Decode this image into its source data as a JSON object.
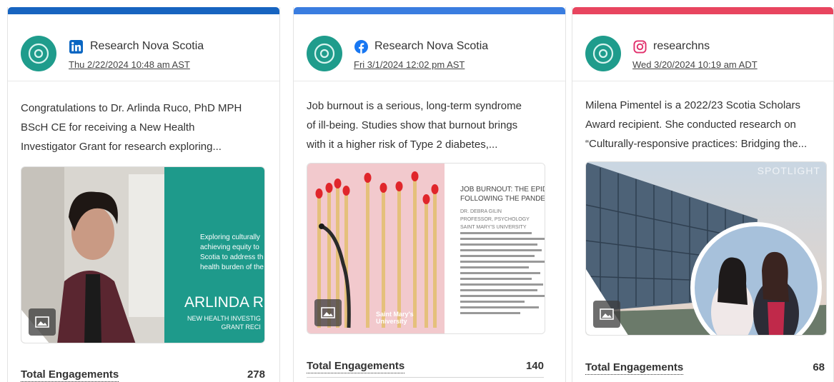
{
  "engagement_label": "Total Engagements",
  "colors": {
    "linkedin": "#0a66c2",
    "facebook": "#1877f2",
    "instagram": "#e1306c",
    "bar_instagram": "#e8455f",
    "avatar": "#1f9c8c"
  },
  "cards": [
    {
      "network": "linkedin",
      "network_icon": "linkedin-icon",
      "account": "Research Nova Scotia",
      "timestamp": "Thu 2/22/2024 10:48 am AST",
      "text_lines": [
        "Congratulations to Dr. Arlinda Ruco, PhD MPH",
        "BScH CE for receiving a New Health",
        "Investigator Grant for research exploring..."
      ],
      "image_lines": [
        "Exploring culturally",
        "achieving equity to",
        "Scotia to address th",
        "health burden of the"
      ],
      "image_name": "ARLINDA RU",
      "image_sub": [
        "NEW HEALTH INVESTIG",
        "GRANT RECI"
      ],
      "engagements": "278"
    },
    {
      "network": "facebook",
      "network_icon": "facebook-icon",
      "account": "Research Nova Scotia",
      "timestamp": "Fri 3/1/2024 12:02 pm AST",
      "text_lines": [
        "Job burnout is a serious, long-term syndrome",
        "of ill-being. Studies show that burnout brings",
        "with it a higher risk of Type 2 diabetes,..."
      ],
      "image_title": [
        "JOB BURNOUT: THE EPID",
        "FOLLOWING THE PANDEM"
      ],
      "image_author": [
        "DR. DEBRA GILIN",
        "PROFESSOR, PSYCHOLOGY",
        "SAINT MARY'S UNIVERSITY"
      ],
      "image_logo": [
        "Saint Mary's",
        "University"
      ],
      "engagements": "140"
    },
    {
      "network": "instagram",
      "network_icon": "instagram-icon",
      "account": "researchns",
      "timestamp": "Wed 3/20/2024 10:19 am ADT",
      "text_lines": [
        "Milena Pimentel is a 2022/23 Scotia Scholars",
        "Award recipient. She conducted research on",
        "“Culturally-responsive practices: Bridging the..."
      ],
      "image_overlay": "SPOTLIGHT",
      "engagements": "68"
    }
  ]
}
